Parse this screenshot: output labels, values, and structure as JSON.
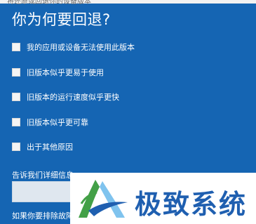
{
  "header": {
    "partial_top_text": "将还原或回退你的设备版本"
  },
  "title": "你为何要回退?",
  "reasons": [
    {
      "label": "我的应用或设备无法使用此版本"
    },
    {
      "label": "旧版本似乎更易于使用"
    },
    {
      "label": "旧版本的运行速度似乎更快"
    },
    {
      "label": "旧版本似乎更可靠"
    },
    {
      "label": "出于其他原因"
    }
  ],
  "details": {
    "label": "告诉我们详细信息",
    "value": ""
  },
  "footer": {
    "help_text": "如果你要排除故障"
  },
  "watermark": {
    "brand": "极致系统",
    "colors": {
      "primary": "#1f5fb0",
      "accent": "#43a047",
      "light_blue": "#7fc3ee"
    }
  },
  "colors": {
    "background": "#1565b3",
    "checkbox": "#f4f4f4",
    "input": "#dfe7ef"
  }
}
